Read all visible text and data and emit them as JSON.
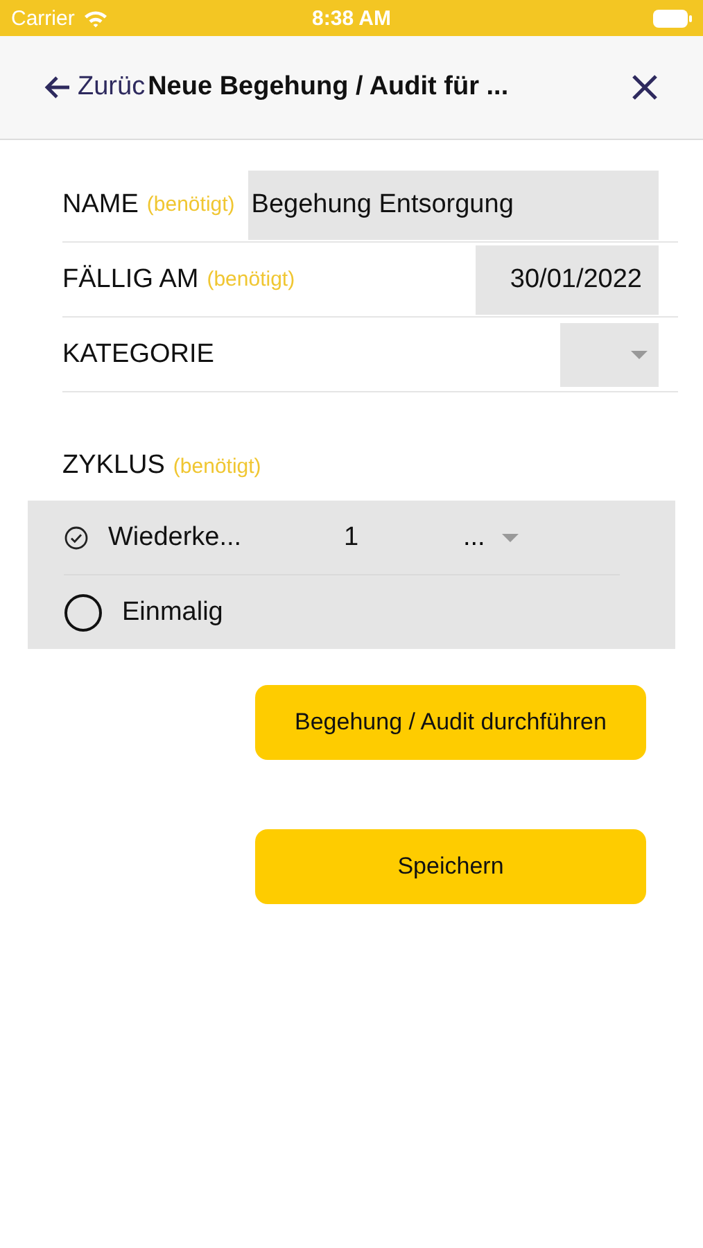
{
  "status_bar": {
    "carrier": "Carrier",
    "time": "8:38 AM"
  },
  "nav": {
    "back": "Zurüc",
    "title": "Neue Begehung / Audit für ..."
  },
  "fields": [
    {
      "kind": "text",
      "label": "NAME",
      "hint": "(benötigt)",
      "value": "Begehung Entsorgung"
    },
    {
      "kind": "date",
      "label": "FÄLLIG AM",
      "hint": "(benötigt)",
      "value": "30/01/2022"
    },
    {
      "kind": "select",
      "label": "KATEGORIE"
    }
  ],
  "cycle": {
    "label": "ZYKLUS",
    "hint": "(benötigt)",
    "options": [
      {
        "label": "Wiederke...",
        "selected": true,
        "count": "1",
        "unit": "..."
      },
      {
        "label": "Einmalig",
        "selected": false
      }
    ]
  },
  "buttons": [
    "Begehung / Audit durchführen",
    "Speichern"
  ]
}
